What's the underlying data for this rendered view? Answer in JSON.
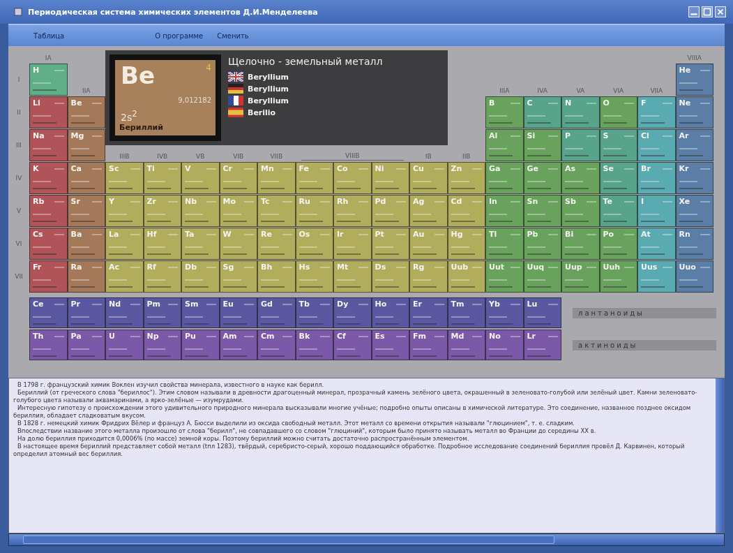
{
  "window": {
    "title": "Периодическая система химических элементов Д.И.Менделеева"
  },
  "menu": [
    {
      "label": "Таблица"
    },
    {
      "label": "О программе"
    },
    {
      "label": "Сменить"
    }
  ],
  "info": {
    "symbol": "Be",
    "number": "4",
    "mass": "9,012182",
    "config": "2s$^{2}$",
    "name": "Бериллий",
    "category": "Щелочно - земельный металл",
    "names": [
      {
        "kind": "uk",
        "label": "Beryllium"
      },
      {
        "kind": "de",
        "label": "Beryllium"
      },
      {
        "kind": "fr",
        "label": "Beryllium"
      },
      {
        "kind": "es",
        "label": "Berilio"
      }
    ]
  },
  "periods": [
    "I",
    "II",
    "III",
    "IV",
    "V",
    "VI",
    "VII"
  ],
  "group_headers": [
    {
      "label": "IA"
    },
    {
      "label": "IIA"
    },
    {
      "label": "IIIB"
    },
    {
      "label": "IVB"
    },
    {
      "label": "VB"
    },
    {
      "label": "VIB"
    },
    {
      "label": "VIIB"
    },
    {
      "label": "VIIIB"
    },
    {
      "label": "IB"
    },
    {
      "label": "IIB"
    },
    {
      "label": "IIIA"
    },
    {
      "label": "IVA"
    },
    {
      "label": "VA"
    },
    {
      "label": "VIA"
    },
    {
      "label": "VIIA"
    },
    {
      "label": "VIIIA"
    }
  ],
  "rows": [
    [
      {
        "symbol": "H",
        "kind": "h"
      },
      null,
      null,
      null,
      null,
      null,
      null,
      null,
      null,
      null,
      null,
      null,
      null,
      null,
      null,
      null,
      null,
      {
        "symbol": "He",
        "kind": "noble"
      }
    ],
    [
      {
        "symbol": "Li",
        "kind": "alkali"
      },
      {
        "symbol": "Be",
        "kind": "alkaline"
      },
      null,
      null,
      null,
      null,
      null,
      null,
      null,
      null,
      null,
      null,
      {
        "symbol": "B",
        "kind": "p"
      },
      {
        "symbol": "C",
        "kind": "nonmetal"
      },
      {
        "symbol": "N",
        "kind": "nonmetal"
      },
      {
        "symbol": "O",
        "kind": "p"
      },
      {
        "symbol": "F",
        "kind": "halogen"
      },
      {
        "symbol": "Ne",
        "kind": "noble"
      }
    ],
    [
      {
        "symbol": "Na",
        "kind": "alkali"
      },
      {
        "symbol": "Mg",
        "kind": "alkaline"
      },
      null,
      null,
      null,
      null,
      null,
      null,
      null,
      null,
      null,
      null,
      {
        "symbol": "Al",
        "kind": "p"
      },
      {
        "symbol": "Si",
        "kind": "p"
      },
      {
        "symbol": "P",
        "kind": "nonmetal"
      },
      {
        "symbol": "S",
        "kind": "nonmetal"
      },
      {
        "symbol": "Cl",
        "kind": "halogen"
      },
      {
        "symbol": "Ar",
        "kind": "noble"
      }
    ],
    [
      {
        "symbol": "K",
        "kind": "alkali"
      },
      {
        "symbol": "Ca",
        "kind": "alkaline"
      },
      {
        "symbol": "Sc",
        "kind": "transition"
      },
      {
        "symbol": "Ti",
        "kind": "transition"
      },
      {
        "symbol": "V",
        "kind": "transition"
      },
      {
        "symbol": "Cr",
        "kind": "transition"
      },
      {
        "symbol": "Mn",
        "kind": "transition"
      },
      {
        "symbol": "Fe",
        "kind": "transition"
      },
      {
        "symbol": "Co",
        "kind": "transition"
      },
      {
        "symbol": "Ni",
        "kind": "transition"
      },
      {
        "symbol": "Cu",
        "kind": "transition"
      },
      {
        "symbol": "Zn",
        "kind": "transition"
      },
      {
        "symbol": "Ga",
        "kind": "p"
      },
      {
        "symbol": "Ge",
        "kind": "p"
      },
      {
        "symbol": "As",
        "kind": "p"
      },
      {
        "symbol": "Se",
        "kind": "nonmetal"
      },
      {
        "symbol": "Br",
        "kind": "halogen"
      },
      {
        "symbol": "Kr",
        "kind": "noble"
      }
    ],
    [
      {
        "symbol": "Rb",
        "kind": "alkali"
      },
      {
        "symbol": "Sr",
        "kind": "alkaline"
      },
      {
        "symbol": "Y",
        "kind": "transition"
      },
      {
        "symbol": "Zr",
        "kind": "transition"
      },
      {
        "symbol": "Nb",
        "kind": "transition"
      },
      {
        "symbol": "Mo",
        "kind": "transition"
      },
      {
        "symbol": "Tc",
        "kind": "transition"
      },
      {
        "symbol": "Ru",
        "kind": "transition"
      },
      {
        "symbol": "Rh",
        "kind": "transition"
      },
      {
        "symbol": "Pd",
        "kind": "transition"
      },
      {
        "symbol": "Ag",
        "kind": "transition"
      },
      {
        "symbol": "Cd",
        "kind": "transition"
      },
      {
        "symbol": "In",
        "kind": "p"
      },
      {
        "symbol": "Sn",
        "kind": "p"
      },
      {
        "symbol": "Sb",
        "kind": "p"
      },
      {
        "symbol": "Te",
        "kind": "nonmetal"
      },
      {
        "symbol": "I",
        "kind": "halogen"
      },
      {
        "symbol": "Xe",
        "kind": "noble"
      }
    ],
    [
      {
        "symbol": "Cs",
        "kind": "alkali"
      },
      {
        "symbol": "Ba",
        "kind": "alkaline"
      },
      {
        "symbol": "La",
        "kind": "transition"
      },
      {
        "symbol": "Hf",
        "kind": "transition"
      },
      {
        "symbol": "Ta",
        "kind": "transition"
      },
      {
        "symbol": "W",
        "kind": "transition"
      },
      {
        "symbol": "Re",
        "kind": "transition"
      },
      {
        "symbol": "Os",
        "kind": "transition"
      },
      {
        "symbol": "Ir",
        "kind": "transition"
      },
      {
        "symbol": "Pt",
        "kind": "transition"
      },
      {
        "symbol": "Au",
        "kind": "transition"
      },
      {
        "symbol": "Hg",
        "kind": "transition"
      },
      {
        "symbol": "Tl",
        "kind": "p"
      },
      {
        "symbol": "Pb",
        "kind": "p"
      },
      {
        "symbol": "Bi",
        "kind": "p"
      },
      {
        "symbol": "Po",
        "kind": "p"
      },
      {
        "symbol": "At",
        "kind": "halogen"
      },
      {
        "symbol": "Rn",
        "kind": "noble"
      }
    ],
    [
      {
        "symbol": "Fr",
        "kind": "alkali"
      },
      {
        "symbol": "Ra",
        "kind": "alkaline"
      },
      {
        "symbol": "Ac",
        "kind": "transition"
      },
      {
        "symbol": "Rf",
        "kind": "transition"
      },
      {
        "symbol": "Db",
        "kind": "transition"
      },
      {
        "symbol": "Sg",
        "kind": "transition"
      },
      {
        "symbol": "Bh",
        "kind": "transition"
      },
      {
        "symbol": "Hs",
        "kind": "transition"
      },
      {
        "symbol": "Mt",
        "kind": "transition"
      },
      {
        "symbol": "Ds",
        "kind": "transition"
      },
      {
        "symbol": "Rg",
        "kind": "transition"
      },
      {
        "symbol": "Uub",
        "kind": "transition"
      },
      {
        "symbol": "Uut",
        "kind": "p"
      },
      {
        "symbol": "Uuq",
        "kind": "p"
      },
      {
        "symbol": "Uup",
        "kind": "p"
      },
      {
        "symbol": "Uuh",
        "kind": "p"
      },
      {
        "symbol": "Uus",
        "kind": "halogen"
      },
      {
        "symbol": "Uuo",
        "kind": "noble"
      }
    ]
  ],
  "series": [
    {
      "label": "лантаноиды",
      "elements": [
        {
          "symbol": "Ce",
          "kind": "lanthanide"
        },
        {
          "symbol": "Pr",
          "kind": "lanthanide"
        },
        {
          "symbol": "Nd",
          "kind": "lanthanide"
        },
        {
          "symbol": "Pm",
          "kind": "lanthanide"
        },
        {
          "symbol": "Sm",
          "kind": "lanthanide"
        },
        {
          "symbol": "Eu",
          "kind": "lanthanide"
        },
        {
          "symbol": "Gd",
          "kind": "lanthanide"
        },
        {
          "symbol": "Tb",
          "kind": "lanthanide"
        },
        {
          "symbol": "Dy",
          "kind": "lanthanide"
        },
        {
          "symbol": "Ho",
          "kind": "lanthanide"
        },
        {
          "symbol": "Er",
          "kind": "lanthanide"
        },
        {
          "symbol": "Tm",
          "kind": "lanthanide"
        },
        {
          "symbol": "Yb",
          "kind": "lanthanide"
        },
        {
          "symbol": "Lu",
          "kind": "lanthanide"
        }
      ]
    },
    {
      "label": "актиноиды",
      "elements": [
        {
          "symbol": "Th",
          "kind": "actinide"
        },
        {
          "symbol": "Pa",
          "kind": "actinide"
        },
        {
          "symbol": "U",
          "kind": "actinide"
        },
        {
          "symbol": "Np",
          "kind": "actinide"
        },
        {
          "symbol": "Pu",
          "kind": "actinide"
        },
        {
          "symbol": "Am",
          "kind": "actinide"
        },
        {
          "symbol": "Cm",
          "kind": "actinide"
        },
        {
          "symbol": "Bk",
          "kind": "actinide"
        },
        {
          "symbol": "Cf",
          "kind": "actinide"
        },
        {
          "symbol": "Es",
          "kind": "actinide"
        },
        {
          "symbol": "Fm",
          "kind": "actinide"
        },
        {
          "symbol": "Md",
          "kind": "actinide"
        },
        {
          "symbol": "No",
          "kind": "actinide"
        },
        {
          "symbol": "Lr",
          "kind": "actinide"
        }
      ]
    }
  ],
  "description": [
    "В 1798 г. французский химик Воклен изучил свойства минерала, известного в науке как берилл.",
    "Бериллий (от греческого слова \"бериллос\"). Этим словом называли в древности драгоценный минерал, прозрачный камень зелёного цвета, окрашенный в зеленовато-голубой или зелёный цвет. Камни зеленовато-голубого цвета называли аквамаринами, а ярко-зелёные — изумрудами.",
    "Интересную гипотезу о происхождении этого удивительного природного минерала высказывали многие учёные; подробно опыты описаны в химической литературе. Это соединение, названное позднее оксидом бериллия, обладает сладковатым вкусом.",
    "В 1828 г. немецкий химик Фридрих Вёлер и француз А. Бюсси выделили из оксида свободный металл. Этот металл со времени открытия называли \"глюцинием\", т. е. сладким.",
    "Впоследствии название этого металла произошло от слова \"берилл\", не совпадавшего со словом \"глюциний\", которым было принято называть металл во Франции до середины XX в.",
    "На долю бериллия приходится 0,0006% (по массе) земной коры. Поэтому бериллий можно считать достаточно распространённым элементом.",
    "В настоящее время бериллий представляет собой металл (tпл 1283), твёрдый, серебристо-серый, хорошо поддающийся обработке. Подробное исследование соединений бериллия провёл Д. Карвинен, который определил атомный вес бериллия."
  ]
}
